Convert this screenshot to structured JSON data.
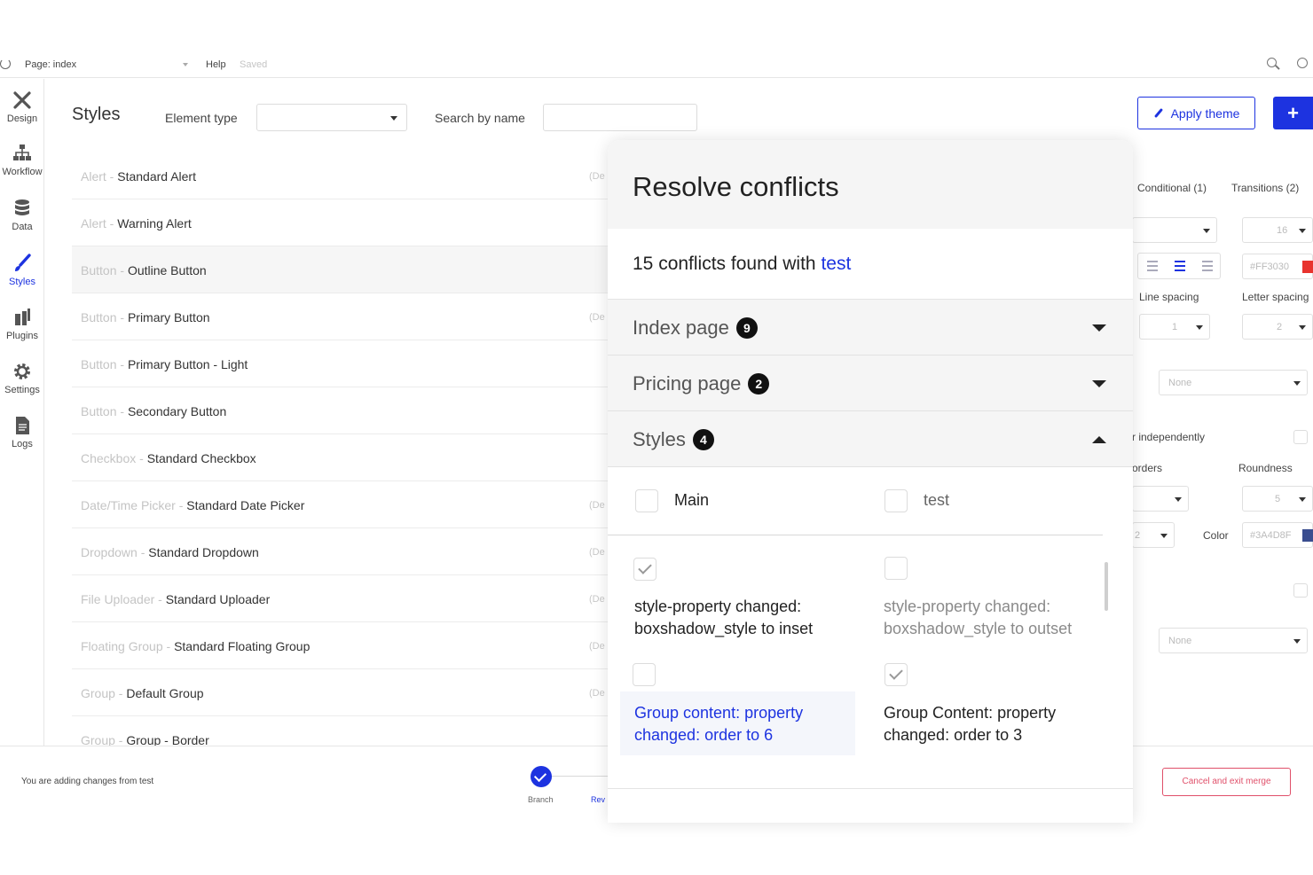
{
  "topbar": {
    "page_label": "Page: index",
    "help": "Help",
    "saved": "Saved"
  },
  "rail": {
    "items": [
      {
        "label": "Design",
        "icon": "design-tools-icon"
      },
      {
        "label": "Workflow",
        "icon": "workflow-icon"
      },
      {
        "label": "Data",
        "icon": "database-icon"
      },
      {
        "label": "Styles",
        "icon": "paintbrush-icon",
        "active": true
      },
      {
        "label": "Plugins",
        "icon": "plugins-icon"
      },
      {
        "label": "Settings",
        "icon": "gear-icon"
      },
      {
        "label": "Logs",
        "icon": "document-icon"
      }
    ]
  },
  "header": {
    "title": "Styles",
    "element_type_label": "Element type",
    "element_type_value": "",
    "search_label": "Search by name",
    "search_value": "",
    "apply_theme": "Apply theme",
    "add": "+"
  },
  "styles_list": [
    {
      "category": "Alert",
      "name": "Standard Alert",
      "default": "(De"
    },
    {
      "category": "Alert",
      "name": "Warning Alert",
      "default": ""
    },
    {
      "category": "Button",
      "name": "Outline Button",
      "default": ""
    },
    {
      "category": "Button",
      "name": "Primary Button",
      "default": "(De"
    },
    {
      "category": "Button",
      "name": "Primary Button - Light",
      "default": ""
    },
    {
      "category": "Button",
      "name": "Secondary Button",
      "default": ""
    },
    {
      "category": "Checkbox",
      "name": "Standard Checkbox",
      "default": ""
    },
    {
      "category": "Date/Time Picker",
      "name": "Standard Date Picker",
      "default": "(De"
    },
    {
      "category": "Dropdown",
      "name": "Standard Dropdown",
      "default": "(De"
    },
    {
      "category": "File Uploader",
      "name": "Standard Uploader",
      "default": "(De"
    },
    {
      "category": "Floating Group",
      "name": "Standard Floating Group",
      "default": "(De"
    },
    {
      "category": "Group",
      "name": "Default Group",
      "default": "(De"
    },
    {
      "category": "Group",
      "name": "Group - Border",
      "default": ""
    }
  ],
  "props": {
    "tab_conditional": "Conditional (1)",
    "tab_transitions": "Transitions (2)",
    "font_size": "16",
    "font_color": "#FF3030",
    "line_spacing_label": "Line spacing",
    "letter_spacing_label": "Letter spacing",
    "line_spacing": "1",
    "letter_spacing": "2",
    "none_1": "None",
    "independently": "r independently",
    "borders_label": "orders",
    "roundness_label": "Roundness",
    "roundness": "5",
    "border_width": "2",
    "color_label": "Color",
    "border_color": "#3A4D8F",
    "none_2": "None",
    "colors": {
      "font_swatch": "#e8332e",
      "border_swatch": "#3a4d8f"
    }
  },
  "modal": {
    "title": "Resolve conflicts",
    "summary_prefix": "15 conflicts found with",
    "summary_branch": "test",
    "sections": [
      {
        "label": "Index page",
        "count": "9",
        "expanded": false
      },
      {
        "label": "Pricing page",
        "count": "2",
        "expanded": false
      },
      {
        "label": "Styles",
        "count": "4",
        "expanded": true
      }
    ],
    "col_main": "Main",
    "col_test": "test",
    "conflicts": [
      {
        "main_text": "style-property changed: boxshadow_style to inset",
        "main_checked": true,
        "test_text": "style-property changed: boxshadow_style to outset",
        "test_checked": false
      },
      {
        "main_text": "Group content: property changed: order to 6",
        "main_checked": false,
        "test_text": "Group Content: property changed: order to 3",
        "test_checked": true
      }
    ]
  },
  "merge_bar": {
    "message": "You are adding changes from test",
    "step1": "Branch",
    "step2": "Rev",
    "cancel": "Cancel and exit merge"
  },
  "colors": {
    "accent": "#1d33e0",
    "danger": "#e0506a"
  }
}
